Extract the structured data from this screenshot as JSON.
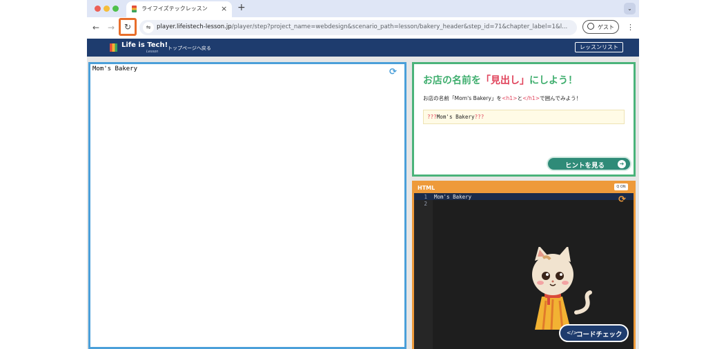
{
  "browser": {
    "tab_title": "ライフイズテックレッスン",
    "tab_close": "×",
    "new_tab": "+",
    "tab_menu": "⌄",
    "back": "←",
    "forward": "→",
    "reload": "↻",
    "site_info": "⇋",
    "url_host": "player.lifeistech-lesson.jp",
    "url_path": "/player/step?project_name=webdesign&scenario_path=lesson/bakery_header&step_id=71&chapter_label=1&l...",
    "guest_label": "ゲスト",
    "menu": "⋮"
  },
  "site": {
    "logo_text": "Life is Tech!",
    "logo_sub": "Lesson",
    "top_link": "トップページへ戻る",
    "lesson_list": "レッスンリスト"
  },
  "preview": {
    "text": "Mom's Bakery",
    "refresh_icon": "refresh-icon"
  },
  "task": {
    "title_prefix": "お店の名前を",
    "title_highlight": "「見出し」",
    "title_suffix": "にしよう！",
    "desc_1": "お店の名前「Mom's Bakery」を",
    "desc_tag_open": "<h1>",
    "desc_2": "と",
    "desc_tag_close": "</h1>",
    "desc_3": "で囲んでみよう！",
    "example_q1": "???",
    "example_text": "Mom's Bakery",
    "example_q2": "???",
    "hint_label": "ヒントを見る",
    "hint_icon": "➔"
  },
  "editor": {
    "label": "HTML",
    "zoom_toggle": "Q ON",
    "line_numbers": [
      "1",
      "2"
    ],
    "line1": "Mom's Bakery",
    "codecheck_icon": "</>",
    "codecheck_label": "コードチェック"
  },
  "colors": {
    "preview_border": "#4a9fd9",
    "task_border": "#4ab37a",
    "editor_border": "#ee9a3a",
    "header_bg": "#1e3c6e",
    "highlight": "#e0425a"
  }
}
